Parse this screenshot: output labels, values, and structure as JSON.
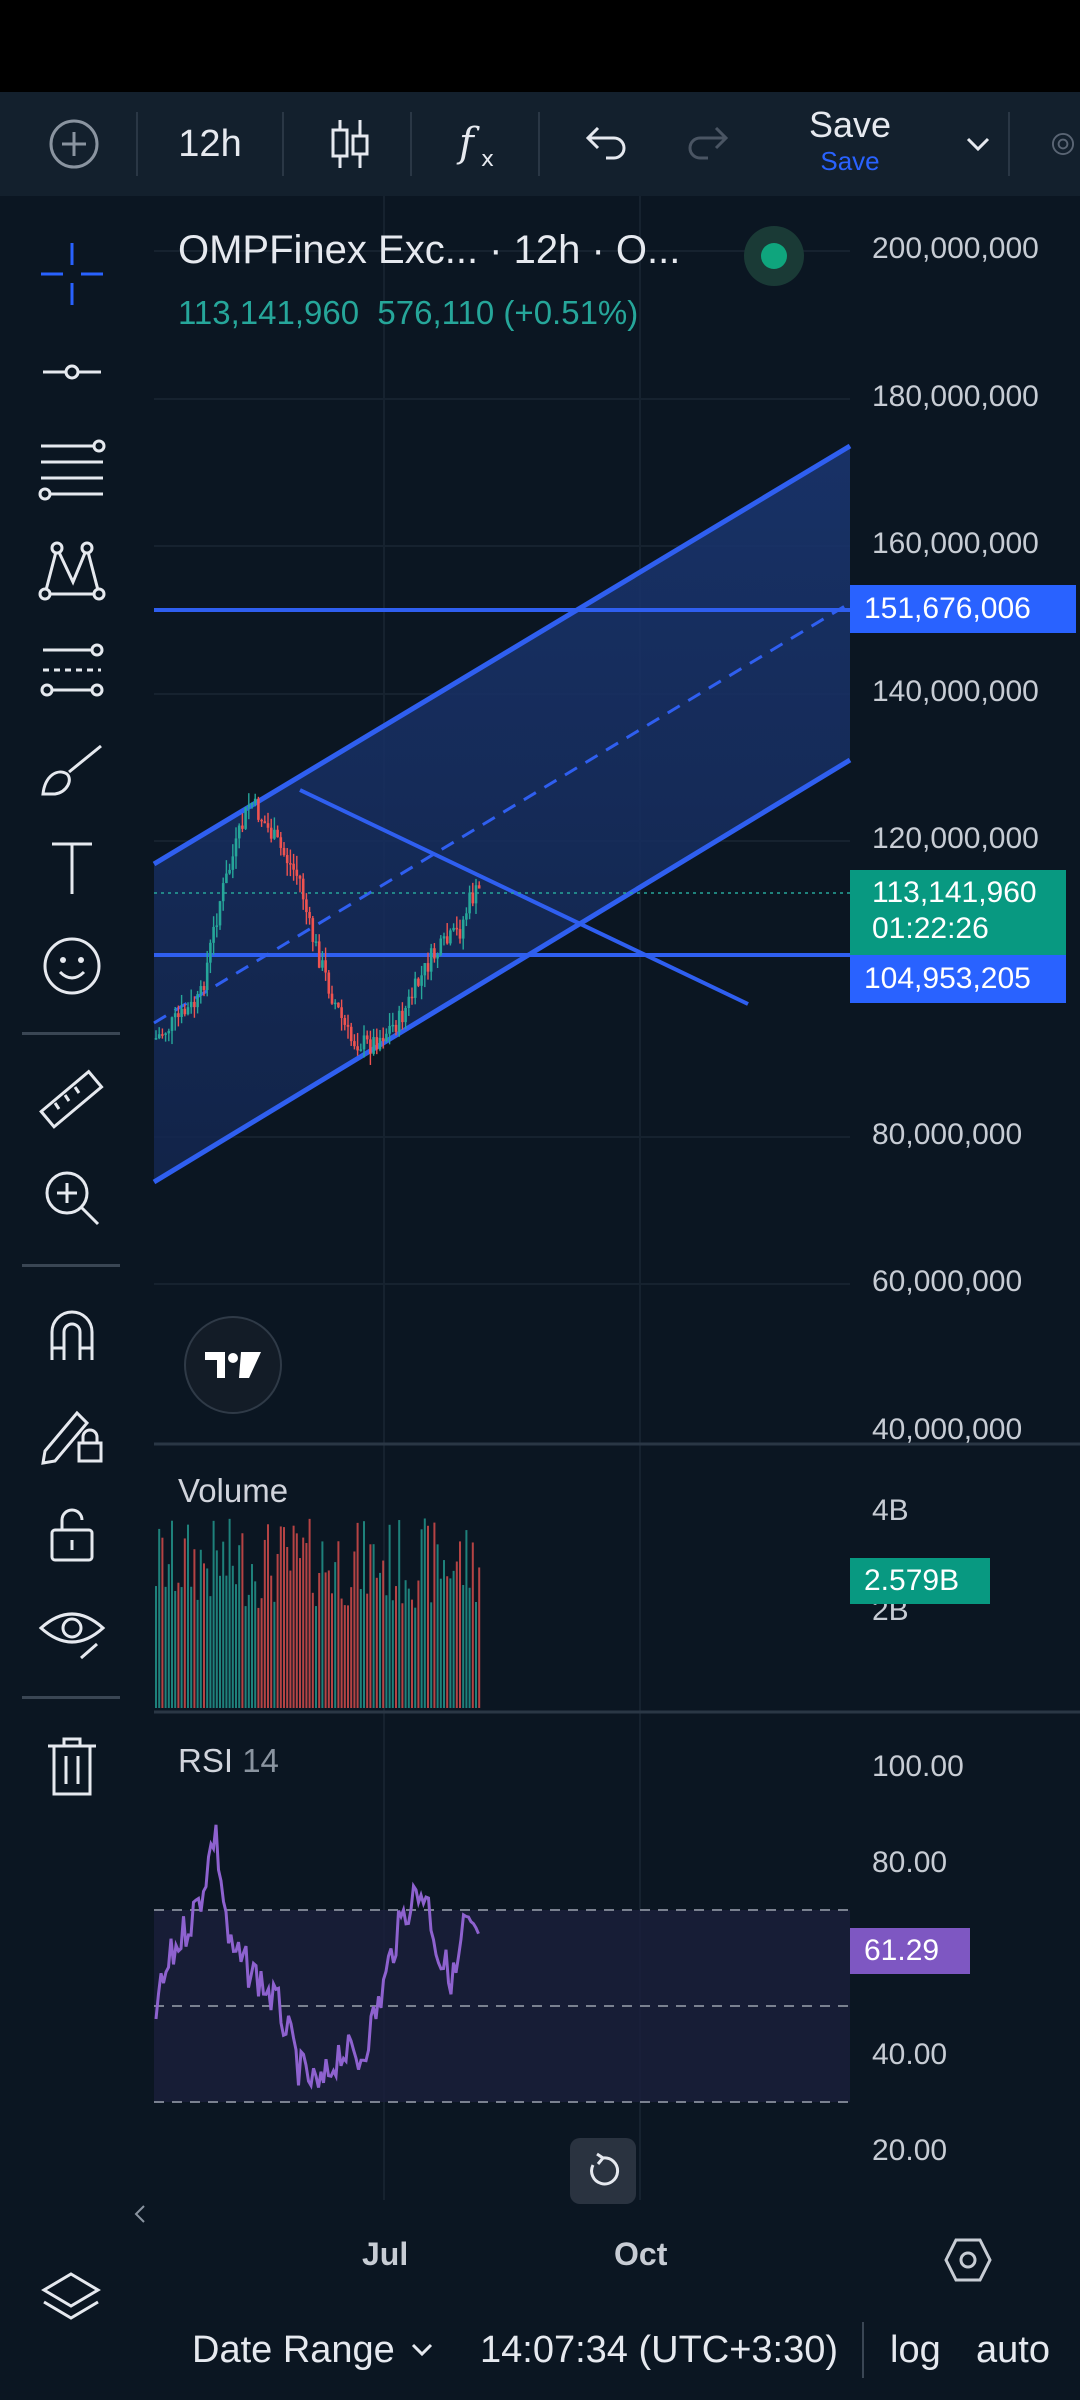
{
  "toolbar": {
    "interval": "12h",
    "save_label": "Save",
    "save_sublabel": "Save"
  },
  "legend": {
    "title": "OMPFinex Exc... · 12h · O...",
    "last_price": "113,141,960",
    "change": "576,110 (+0.51%)"
  },
  "price_axis": {
    "ticks": [
      "200,000,000",
      "180,000,000",
      "160,000,000",
      "140,000,000",
      "120,000,000",
      "80,000,000",
      "60,000,000",
      "40,000,000"
    ],
    "tags": {
      "resistance": "151,676,006",
      "current_price": "113,141,960",
      "countdown": "01:22:26",
      "support": "104,953,205"
    }
  },
  "volume_pane": {
    "label": "Volume",
    "ticks": [
      "4B",
      "2B"
    ],
    "current": "2.579B"
  },
  "rsi_pane": {
    "label": "RSI",
    "period": "14",
    "ticks": [
      "100.00",
      "80.00",
      "40.00",
      "20.00"
    ],
    "current": "61.29"
  },
  "time_axis": {
    "ticks": [
      "Jul",
      "Oct"
    ]
  },
  "bottom": {
    "date_range": "Date Range",
    "clock": "14:07:34 (UTC+3:30)",
    "log": "log",
    "auto": "auto"
  },
  "colors": {
    "background": "#0b1622",
    "drawing_blue": "#2f5ff0",
    "up": "#26a69a",
    "down": "#ef5350",
    "rsi": "#8e62cf",
    "last_price_tag": "#089981"
  }
}
